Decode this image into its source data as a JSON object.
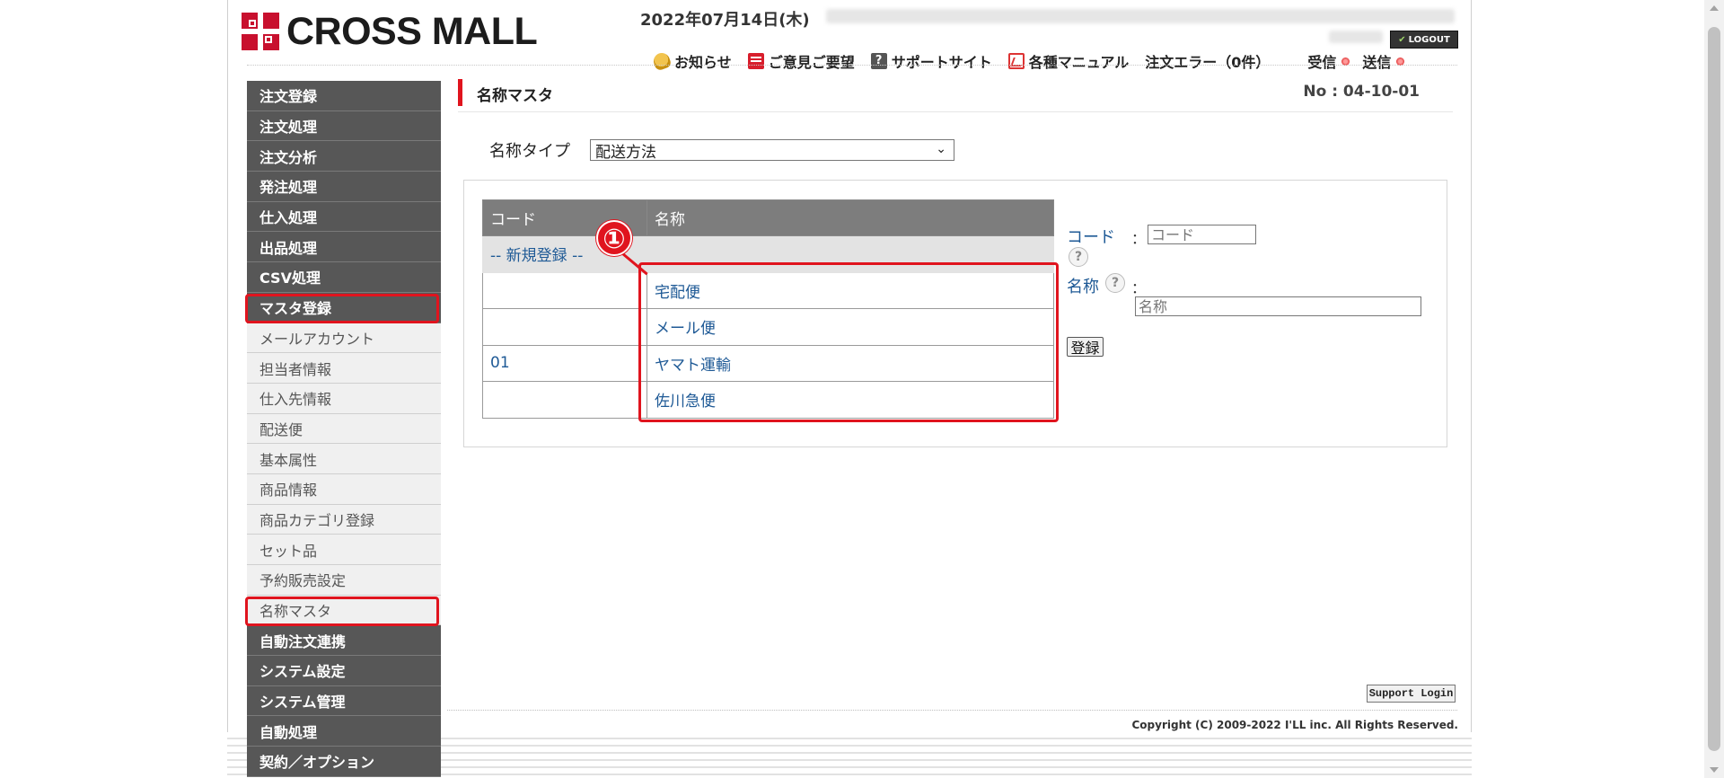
{
  "header": {
    "brand": "CROSS MALL",
    "date": "2022年07月14日(木)",
    "logout_label": "LOGOUT",
    "nav": [
      {
        "label": "お知らせ",
        "icon": "bell-icon"
      },
      {
        "label": "ご意見ご要望",
        "icon": "mailbox-icon"
      },
      {
        "label": "サポートサイト",
        "icon": "help-icon"
      },
      {
        "label": "各種マニュアル",
        "icon": "pdf-icon"
      },
      {
        "label": "注文エラー（0件）",
        "icon": ""
      },
      {
        "label": "受信",
        "icon": "status-dot-icon"
      },
      {
        "label": "送信",
        "icon": "status-dot-icon"
      }
    ]
  },
  "sidebar": {
    "items": [
      {
        "label": "注文登録",
        "style": "dark"
      },
      {
        "label": "注文処理",
        "style": "dark"
      },
      {
        "label": "注文分析",
        "style": "dark"
      },
      {
        "label": "発注処理",
        "style": "dark"
      },
      {
        "label": "仕入処理",
        "style": "dark"
      },
      {
        "label": "出品処理",
        "style": "dark"
      },
      {
        "label": "CSV処理",
        "style": "dark"
      },
      {
        "label": "マスタ登録",
        "style": "dark"
      },
      {
        "label": "メールアカウント",
        "style": "light"
      },
      {
        "label": "担当者情報",
        "style": "light"
      },
      {
        "label": "仕入先情報",
        "style": "light"
      },
      {
        "label": "配送便",
        "style": "light"
      },
      {
        "label": "基本属性",
        "style": "light"
      },
      {
        "label": "商品情報",
        "style": "light"
      },
      {
        "label": "商品カテゴリ登録",
        "style": "light"
      },
      {
        "label": "セット品",
        "style": "light"
      },
      {
        "label": "予約販売設定",
        "style": "light"
      },
      {
        "label": "名称マスタ",
        "style": "light"
      },
      {
        "label": "自動注文連携",
        "style": "dark"
      },
      {
        "label": "システム設定",
        "style": "dark"
      },
      {
        "label": "システム管理",
        "style": "dark"
      },
      {
        "label": "自動処理",
        "style": "dark"
      },
      {
        "label": "契約／オプション",
        "style": "dark"
      }
    ]
  },
  "page": {
    "title": "名称マスタ",
    "screen_no": "No : 04-10-01",
    "type_label": "名称タイプ",
    "type_selected": "配送方法"
  },
  "table": {
    "headers": [
      "コード",
      "名称"
    ],
    "new_entry_label": "-- 新規登録 --",
    "rows": [
      {
        "code": "",
        "name": "宅配便"
      },
      {
        "code": "",
        "name": "メール便"
      },
      {
        "code": "01",
        "name": "ヤマト運輸"
      },
      {
        "code": "",
        "name": "佐川急便"
      }
    ]
  },
  "annotation": {
    "badge": "①"
  },
  "form": {
    "code_label": "コード",
    "code_placeholder": "コード",
    "name_label": "名称",
    "name_placeholder": "名称",
    "colon": "：",
    "help_glyph": "?",
    "register_label": "登録"
  },
  "footer": {
    "support_label": "Support Login",
    "copyright": "Copyright (C) 2009-2022 I'LL inc. All Rights Reserved."
  },
  "colors": {
    "accent_red": "#e0141e",
    "menu_dark": "#575757",
    "menu_light": "#f0f0f0",
    "link_blue": "#1f5a96"
  }
}
